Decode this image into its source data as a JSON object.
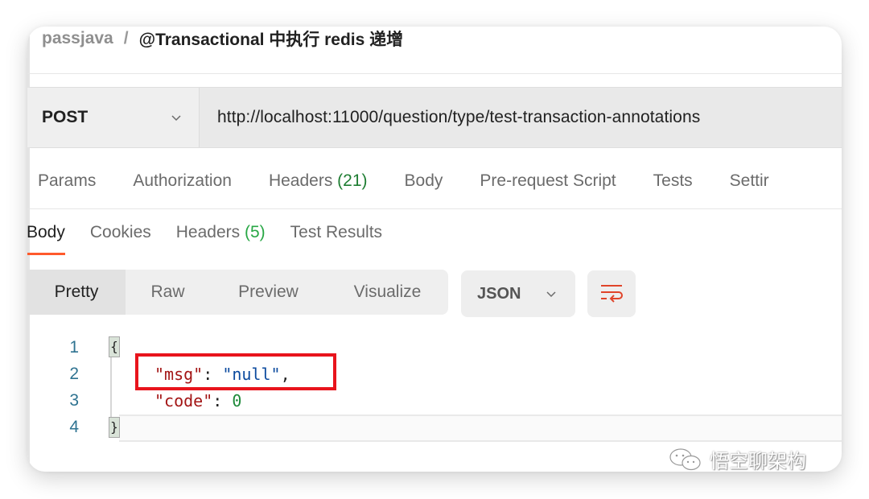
{
  "breadcrumb": {
    "parent": "passjava",
    "separator": "/",
    "title": "@Transactional 中执行 redis 递增"
  },
  "request": {
    "method": "POST",
    "url": "http://localhost:11000/question/type/test-transaction-annotations"
  },
  "request_tabs": [
    {
      "label": "Params"
    },
    {
      "label": "Authorization"
    },
    {
      "label": "Headers",
      "count": "(21)"
    },
    {
      "label": "Body"
    },
    {
      "label": "Pre-request Script"
    },
    {
      "label": "Tests"
    },
    {
      "label": "Settir"
    }
  ],
  "response_tabs": [
    {
      "label": "Body",
      "active": true
    },
    {
      "label": "Cookies"
    },
    {
      "label": "Headers",
      "count": "(5)"
    },
    {
      "label": "Test Results"
    }
  ],
  "view_modes": [
    {
      "label": "Pretty",
      "active": true
    },
    {
      "label": "Raw"
    },
    {
      "label": "Preview"
    },
    {
      "label": "Visualize"
    }
  ],
  "format_select": {
    "value": "JSON"
  },
  "wrap_button": {
    "icon": "text-wrap-icon",
    "color": "#e0442a"
  },
  "response_body": {
    "lines": [
      {
        "n": "1",
        "text": "{"
      },
      {
        "n": "2",
        "key": "\"msg\"",
        "sep": ": ",
        "value": "\"null\"",
        "trail": ","
      },
      {
        "n": "3",
        "key": "\"code\"",
        "sep": ": ",
        "value": "0"
      },
      {
        "n": "4",
        "text": "}"
      }
    ]
  },
  "annotation": {
    "color": "#e8141c",
    "target": "msg line"
  },
  "watermark": {
    "text": "悟空聊架构",
    "icon": "wechat-icon"
  },
  "colors": {
    "accent": "#ff5a2c",
    "count_green": "#1e7d32",
    "key_red": "#a31515",
    "string_blue": "#0b4a9e",
    "number_green": "#1e8a3a",
    "line_number": "#2f7391"
  }
}
